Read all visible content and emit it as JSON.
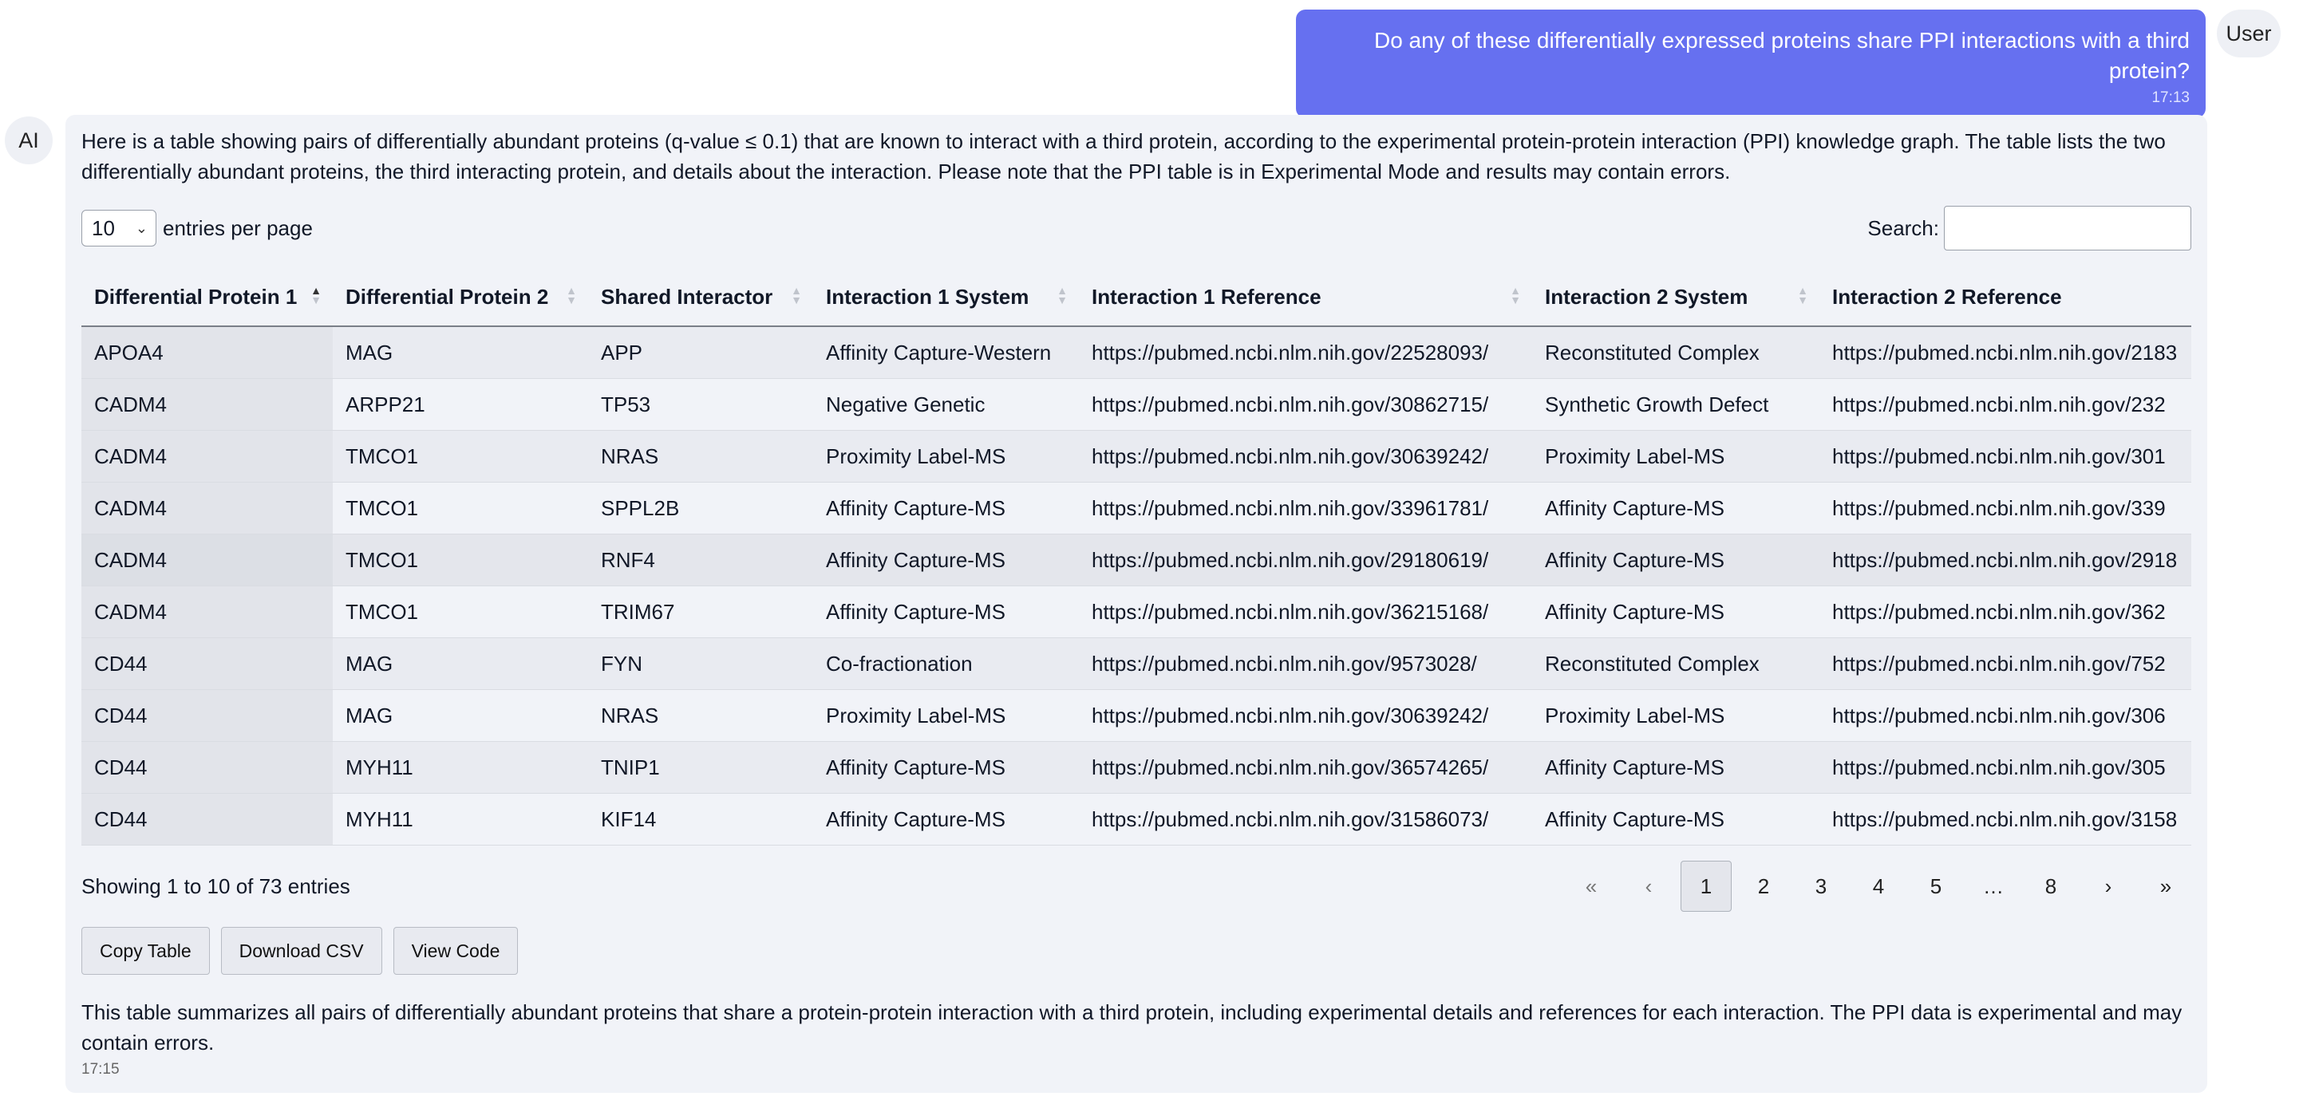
{
  "user_message": {
    "text": "Do any of these differentially expressed proteins share PPI interactions with a third protein?",
    "time": "17:13",
    "avatar_label": "User"
  },
  "ai_message": {
    "avatar_label": "AI",
    "intro": "Here is a table showing pairs of differentially abundant proteins (q-value ≤ 0.1) that are known to interact with a third protein, according to the experimental protein-protein interaction (PPI) knowledge graph. The table lists the two differentially abundant proteins, the third interacting protein, and details about the interaction. Please note that the PPI table is in Experimental Mode and results may contain errors.",
    "summary": "This table summarizes all pairs of differentially abundant proteins that share a protein-protein interaction with a third protein, including experimental details and references for each interaction. The PPI data is experimental and may contain errors.",
    "time": "17:15"
  },
  "controls": {
    "page_size": "10",
    "entries_label": "entries per page",
    "search_label": "Search:",
    "search_value": ""
  },
  "table": {
    "columns": [
      "Differential Protein 1",
      "Differential Protein 2",
      "Shared Interactor",
      "Interaction 1 System",
      "Interaction 1 Reference",
      "Interaction 2 System",
      "Interaction 2 Reference"
    ],
    "rows": [
      [
        "APOA4",
        "MAG",
        "APP",
        "Affinity Capture-Western",
        "https://pubmed.ncbi.nlm.nih.gov/22528093/",
        "Reconstituted Complex",
        "https://pubmed.ncbi.nlm.nih.gov/2183"
      ],
      [
        "CADM4",
        "ARPP21",
        "TP53",
        "Negative Genetic",
        "https://pubmed.ncbi.nlm.nih.gov/30862715/",
        "Synthetic Growth Defect",
        "https://pubmed.ncbi.nlm.nih.gov/232"
      ],
      [
        "CADM4",
        "TMCO1",
        "NRAS",
        "Proximity Label-MS",
        "https://pubmed.ncbi.nlm.nih.gov/30639242/",
        "Proximity Label-MS",
        "https://pubmed.ncbi.nlm.nih.gov/301"
      ],
      [
        "CADM4",
        "TMCO1",
        "SPPL2B",
        "Affinity Capture-MS",
        "https://pubmed.ncbi.nlm.nih.gov/33961781/",
        "Affinity Capture-MS",
        "https://pubmed.ncbi.nlm.nih.gov/339"
      ],
      [
        "CADM4",
        "TMCO1",
        "RNF4",
        "Affinity Capture-MS",
        "https://pubmed.ncbi.nlm.nih.gov/29180619/",
        "Affinity Capture-MS",
        "https://pubmed.ncbi.nlm.nih.gov/2918"
      ],
      [
        "CADM4",
        "TMCO1",
        "TRIM67",
        "Affinity Capture-MS",
        "https://pubmed.ncbi.nlm.nih.gov/36215168/",
        "Affinity Capture-MS",
        "https://pubmed.ncbi.nlm.nih.gov/362"
      ],
      [
        "CD44",
        "MAG",
        "FYN",
        "Co-fractionation",
        "https://pubmed.ncbi.nlm.nih.gov/9573028/",
        "Reconstituted Complex",
        "https://pubmed.ncbi.nlm.nih.gov/752"
      ],
      [
        "CD44",
        "MAG",
        "NRAS",
        "Proximity Label-MS",
        "https://pubmed.ncbi.nlm.nih.gov/30639242/",
        "Proximity Label-MS",
        "https://pubmed.ncbi.nlm.nih.gov/306"
      ],
      [
        "CD44",
        "MYH11",
        "TNIP1",
        "Affinity Capture-MS",
        "https://pubmed.ncbi.nlm.nih.gov/36574265/",
        "Affinity Capture-MS",
        "https://pubmed.ncbi.nlm.nih.gov/305"
      ],
      [
        "CD44",
        "MYH11",
        "KIF14",
        "Affinity Capture-MS",
        "https://pubmed.ncbi.nlm.nih.gov/31586073/",
        "Affinity Capture-MS",
        "https://pubmed.ncbi.nlm.nih.gov/3158"
      ]
    ]
  },
  "pagination": {
    "info": "Showing 1 to 10 of 73 entries",
    "first": "«",
    "prev": "‹",
    "pages": [
      "1",
      "2",
      "3",
      "4",
      "5",
      "…",
      "8"
    ],
    "current": "1",
    "next": "›",
    "last": "»"
  },
  "buttons": {
    "copy": "Copy Table",
    "download": "Download CSV",
    "view_code": "View Code"
  },
  "icons": {
    "sort": "sort-icon",
    "chevron": "chevron-down-icon"
  }
}
